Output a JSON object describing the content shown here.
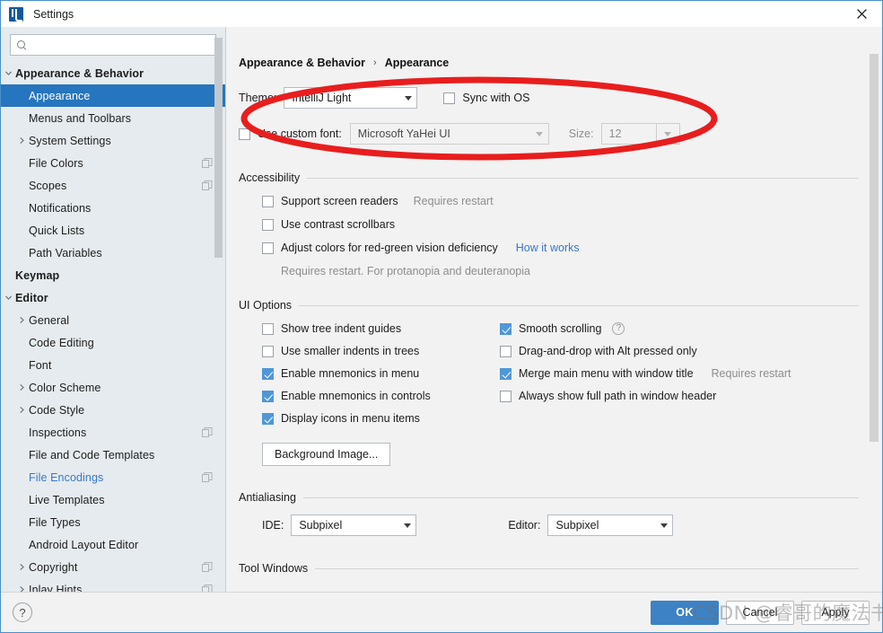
{
  "window": {
    "title": "Settings",
    "app_icon": "intellij-idea-icon",
    "close_icon": "close-icon"
  },
  "sidebar": {
    "search": {
      "value": "",
      "placeholder": "",
      "icon": "search-icon"
    },
    "items": [
      {
        "label": "Appearance & Behavior",
        "indent": 0,
        "arrow": "down",
        "bold": true,
        "selected": false,
        "badge": false,
        "link": false
      },
      {
        "label": "Appearance",
        "indent": 1,
        "arrow": "none",
        "bold": false,
        "selected": true,
        "badge": false,
        "link": false
      },
      {
        "label": "Menus and Toolbars",
        "indent": 1,
        "arrow": "none",
        "bold": false,
        "selected": false,
        "badge": false,
        "link": false
      },
      {
        "label": "System Settings",
        "indent": 1,
        "arrow": "right",
        "bold": false,
        "selected": false,
        "badge": false,
        "link": false
      },
      {
        "label": "File Colors",
        "indent": 1,
        "arrow": "none",
        "bold": false,
        "selected": false,
        "badge": true,
        "link": false
      },
      {
        "label": "Scopes",
        "indent": 1,
        "arrow": "none",
        "bold": false,
        "selected": false,
        "badge": true,
        "link": false
      },
      {
        "label": "Notifications",
        "indent": 1,
        "arrow": "none",
        "bold": false,
        "selected": false,
        "badge": false,
        "link": false
      },
      {
        "label": "Quick Lists",
        "indent": 1,
        "arrow": "none",
        "bold": false,
        "selected": false,
        "badge": false,
        "link": false
      },
      {
        "label": "Path Variables",
        "indent": 1,
        "arrow": "none",
        "bold": false,
        "selected": false,
        "badge": false,
        "link": false
      },
      {
        "label": "Keymap",
        "indent": 0,
        "arrow": "none",
        "bold": true,
        "selected": false,
        "badge": false,
        "link": false
      },
      {
        "label": "Editor",
        "indent": 0,
        "arrow": "down",
        "bold": true,
        "selected": false,
        "badge": false,
        "link": false
      },
      {
        "label": "General",
        "indent": 1,
        "arrow": "right",
        "bold": false,
        "selected": false,
        "badge": false,
        "link": false
      },
      {
        "label": "Code Editing",
        "indent": 1,
        "arrow": "none",
        "bold": false,
        "selected": false,
        "badge": false,
        "link": false
      },
      {
        "label": "Font",
        "indent": 1,
        "arrow": "none",
        "bold": false,
        "selected": false,
        "badge": false,
        "link": false
      },
      {
        "label": "Color Scheme",
        "indent": 1,
        "arrow": "right",
        "bold": false,
        "selected": false,
        "badge": false,
        "link": false
      },
      {
        "label": "Code Style",
        "indent": 1,
        "arrow": "right",
        "bold": false,
        "selected": false,
        "badge": false,
        "link": false
      },
      {
        "label": "Inspections",
        "indent": 1,
        "arrow": "none",
        "bold": false,
        "selected": false,
        "badge": true,
        "link": false
      },
      {
        "label": "File and Code Templates",
        "indent": 1,
        "arrow": "none",
        "bold": false,
        "selected": false,
        "badge": false,
        "link": false
      },
      {
        "label": "File Encodings",
        "indent": 1,
        "arrow": "none",
        "bold": false,
        "selected": false,
        "badge": true,
        "link": true
      },
      {
        "label": "Live Templates",
        "indent": 1,
        "arrow": "none",
        "bold": false,
        "selected": false,
        "badge": false,
        "link": false
      },
      {
        "label": "File Types",
        "indent": 1,
        "arrow": "none",
        "bold": false,
        "selected": false,
        "badge": false,
        "link": false
      },
      {
        "label": "Android Layout Editor",
        "indent": 1,
        "arrow": "none",
        "bold": false,
        "selected": false,
        "badge": false,
        "link": false
      },
      {
        "label": "Copyright",
        "indent": 1,
        "arrow": "right",
        "bold": false,
        "selected": false,
        "badge": true,
        "link": false
      },
      {
        "label": "Inlay Hints",
        "indent": 1,
        "arrow": "right",
        "bold": false,
        "selected": false,
        "badge": true,
        "link": false
      }
    ]
  },
  "main": {
    "breadcrumb": {
      "root": "Appearance & Behavior",
      "separator": "›",
      "leaf": "Appearance"
    },
    "theme": {
      "label": "Theme:",
      "value": "IntelliJ Light",
      "sync_label": "Sync with OS",
      "sync_checked": false
    },
    "custom_font": {
      "label": "Use custom font:",
      "checked": false,
      "value": "Microsoft YaHei UI",
      "size_label": "Size:",
      "size_value": "12"
    },
    "accessibility": {
      "title": "Accessibility",
      "options": [
        {
          "label": "Support screen readers",
          "checked": false,
          "hint": "Requires restart",
          "link": ""
        },
        {
          "label": "Use contrast scrollbars",
          "checked": false,
          "hint": "",
          "link": ""
        },
        {
          "label": "Adjust colors for red-green vision deficiency",
          "checked": false,
          "hint": "",
          "link": "How it works"
        }
      ],
      "note": "Requires restart. For protanopia and deuteranopia"
    },
    "ui_options": {
      "title": "UI Options",
      "left": [
        {
          "label": "Show tree indent guides",
          "checked": false
        },
        {
          "label": "Use smaller indents in trees",
          "checked": false
        },
        {
          "label": "Enable mnemonics in menu",
          "checked": true
        },
        {
          "label": "Enable mnemonics in controls",
          "checked": true
        },
        {
          "label": "Display icons in menu items",
          "checked": true
        }
      ],
      "right": [
        {
          "label": "Smooth scrolling",
          "checked": true,
          "help": true,
          "hint": ""
        },
        {
          "label": "Drag-and-drop with Alt pressed only",
          "checked": false,
          "help": false,
          "hint": ""
        },
        {
          "label": "Merge main menu with window title",
          "checked": true,
          "help": false,
          "hint": "Requires restart"
        },
        {
          "label": "Always show full path in window header",
          "checked": false,
          "help": false,
          "hint": ""
        }
      ],
      "background_image_button": "Background Image..."
    },
    "antialiasing": {
      "title": "Antialiasing",
      "ide_label": "IDE:",
      "ide_value": "Subpixel",
      "editor_label": "Editor:",
      "editor_value": "Subpixel"
    },
    "tool_windows": {
      "title": "Tool Windows"
    }
  },
  "footer": {
    "help_glyph": "?",
    "ok": "OK",
    "cancel": "Cancel",
    "apply": "Apply"
  },
  "watermark": {
    "text": "CSDN @睿哥的魔法书"
  },
  "colors": {
    "selection": "#2675bf",
    "accent_link": "#3a77c9",
    "checkbox_checked": "#4f97d8",
    "annotation_red": "#e81e1e",
    "primary_button": "#3d82c4",
    "sidebar_bg": "#e6ebef",
    "main_bg": "#f2f2f2"
  }
}
